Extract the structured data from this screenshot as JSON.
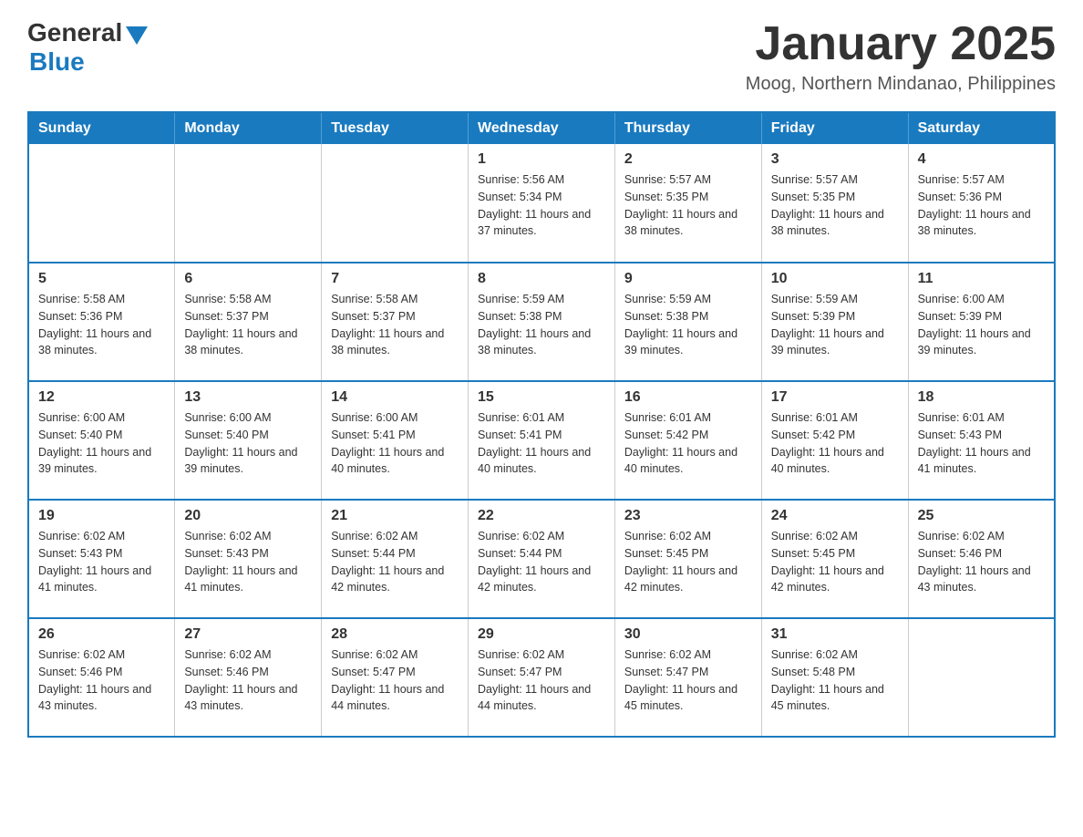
{
  "header": {
    "logo_general": "General",
    "logo_blue": "Blue",
    "month_title": "January 2025",
    "location": "Moog, Northern Mindanao, Philippines"
  },
  "calendar": {
    "days_of_week": [
      "Sunday",
      "Monday",
      "Tuesday",
      "Wednesday",
      "Thursday",
      "Friday",
      "Saturday"
    ],
    "weeks": [
      [
        {
          "day": "",
          "info": ""
        },
        {
          "day": "",
          "info": ""
        },
        {
          "day": "",
          "info": ""
        },
        {
          "day": "1",
          "info": "Sunrise: 5:56 AM\nSunset: 5:34 PM\nDaylight: 11 hours and 37 minutes."
        },
        {
          "day": "2",
          "info": "Sunrise: 5:57 AM\nSunset: 5:35 PM\nDaylight: 11 hours and 38 minutes."
        },
        {
          "day": "3",
          "info": "Sunrise: 5:57 AM\nSunset: 5:35 PM\nDaylight: 11 hours and 38 minutes."
        },
        {
          "day": "4",
          "info": "Sunrise: 5:57 AM\nSunset: 5:36 PM\nDaylight: 11 hours and 38 minutes."
        }
      ],
      [
        {
          "day": "5",
          "info": "Sunrise: 5:58 AM\nSunset: 5:36 PM\nDaylight: 11 hours and 38 minutes."
        },
        {
          "day": "6",
          "info": "Sunrise: 5:58 AM\nSunset: 5:37 PM\nDaylight: 11 hours and 38 minutes."
        },
        {
          "day": "7",
          "info": "Sunrise: 5:58 AM\nSunset: 5:37 PM\nDaylight: 11 hours and 38 minutes."
        },
        {
          "day": "8",
          "info": "Sunrise: 5:59 AM\nSunset: 5:38 PM\nDaylight: 11 hours and 38 minutes."
        },
        {
          "day": "9",
          "info": "Sunrise: 5:59 AM\nSunset: 5:38 PM\nDaylight: 11 hours and 39 minutes."
        },
        {
          "day": "10",
          "info": "Sunrise: 5:59 AM\nSunset: 5:39 PM\nDaylight: 11 hours and 39 minutes."
        },
        {
          "day": "11",
          "info": "Sunrise: 6:00 AM\nSunset: 5:39 PM\nDaylight: 11 hours and 39 minutes."
        }
      ],
      [
        {
          "day": "12",
          "info": "Sunrise: 6:00 AM\nSunset: 5:40 PM\nDaylight: 11 hours and 39 minutes."
        },
        {
          "day": "13",
          "info": "Sunrise: 6:00 AM\nSunset: 5:40 PM\nDaylight: 11 hours and 39 minutes."
        },
        {
          "day": "14",
          "info": "Sunrise: 6:00 AM\nSunset: 5:41 PM\nDaylight: 11 hours and 40 minutes."
        },
        {
          "day": "15",
          "info": "Sunrise: 6:01 AM\nSunset: 5:41 PM\nDaylight: 11 hours and 40 minutes."
        },
        {
          "day": "16",
          "info": "Sunrise: 6:01 AM\nSunset: 5:42 PM\nDaylight: 11 hours and 40 minutes."
        },
        {
          "day": "17",
          "info": "Sunrise: 6:01 AM\nSunset: 5:42 PM\nDaylight: 11 hours and 40 minutes."
        },
        {
          "day": "18",
          "info": "Sunrise: 6:01 AM\nSunset: 5:43 PM\nDaylight: 11 hours and 41 minutes."
        }
      ],
      [
        {
          "day": "19",
          "info": "Sunrise: 6:02 AM\nSunset: 5:43 PM\nDaylight: 11 hours and 41 minutes."
        },
        {
          "day": "20",
          "info": "Sunrise: 6:02 AM\nSunset: 5:43 PM\nDaylight: 11 hours and 41 minutes."
        },
        {
          "day": "21",
          "info": "Sunrise: 6:02 AM\nSunset: 5:44 PM\nDaylight: 11 hours and 42 minutes."
        },
        {
          "day": "22",
          "info": "Sunrise: 6:02 AM\nSunset: 5:44 PM\nDaylight: 11 hours and 42 minutes."
        },
        {
          "day": "23",
          "info": "Sunrise: 6:02 AM\nSunset: 5:45 PM\nDaylight: 11 hours and 42 minutes."
        },
        {
          "day": "24",
          "info": "Sunrise: 6:02 AM\nSunset: 5:45 PM\nDaylight: 11 hours and 42 minutes."
        },
        {
          "day": "25",
          "info": "Sunrise: 6:02 AM\nSunset: 5:46 PM\nDaylight: 11 hours and 43 minutes."
        }
      ],
      [
        {
          "day": "26",
          "info": "Sunrise: 6:02 AM\nSunset: 5:46 PM\nDaylight: 11 hours and 43 minutes."
        },
        {
          "day": "27",
          "info": "Sunrise: 6:02 AM\nSunset: 5:46 PM\nDaylight: 11 hours and 43 minutes."
        },
        {
          "day": "28",
          "info": "Sunrise: 6:02 AM\nSunset: 5:47 PM\nDaylight: 11 hours and 44 minutes."
        },
        {
          "day": "29",
          "info": "Sunrise: 6:02 AM\nSunset: 5:47 PM\nDaylight: 11 hours and 44 minutes."
        },
        {
          "day": "30",
          "info": "Sunrise: 6:02 AM\nSunset: 5:47 PM\nDaylight: 11 hours and 45 minutes."
        },
        {
          "day": "31",
          "info": "Sunrise: 6:02 AM\nSunset: 5:48 PM\nDaylight: 11 hours and 45 minutes."
        },
        {
          "day": "",
          "info": ""
        }
      ]
    ]
  }
}
